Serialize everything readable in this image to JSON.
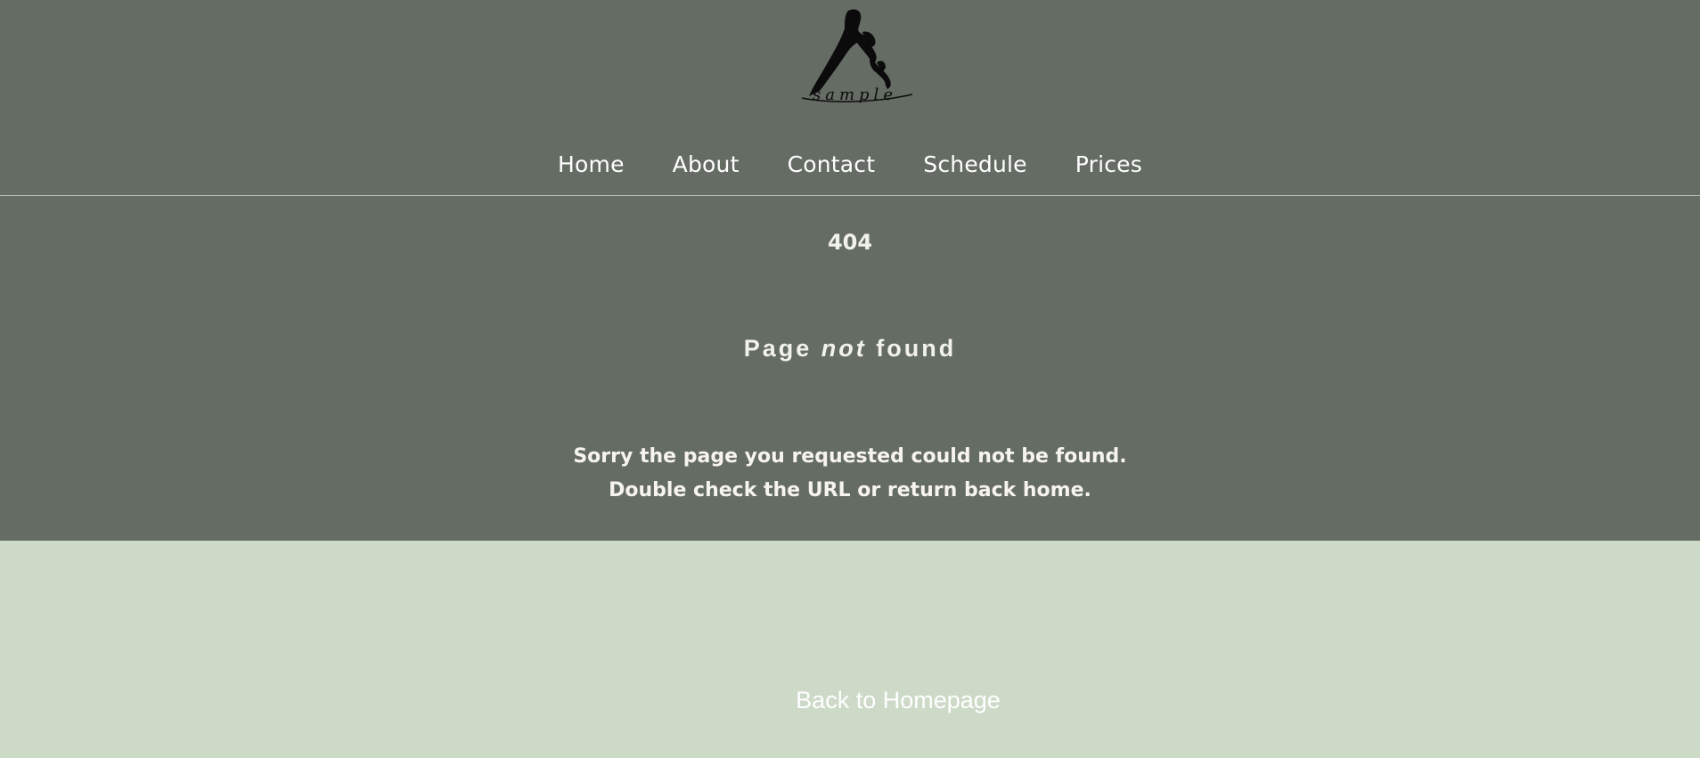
{
  "brand": {
    "logo_text": "sample",
    "logo_icon": "yoga-pose-icon"
  },
  "nav": {
    "items": [
      {
        "label": "Home"
      },
      {
        "label": "About"
      },
      {
        "label": "Contact"
      },
      {
        "label": "Schedule"
      },
      {
        "label": "Prices"
      }
    ]
  },
  "error": {
    "code": "404",
    "headline_prefix": "Page ",
    "headline_emphasis": "not",
    "headline_suffix": " found",
    "message_line_1": "Sorry the page you requested could not be found.",
    "message_line_2": "Double check the URL or return back home."
  },
  "footer": {
    "back_label": "Back to Homepage"
  },
  "colors": {
    "header_bg": "#646c63",
    "page_bg": "#cddac8",
    "text_light": "#f2f2ec"
  }
}
